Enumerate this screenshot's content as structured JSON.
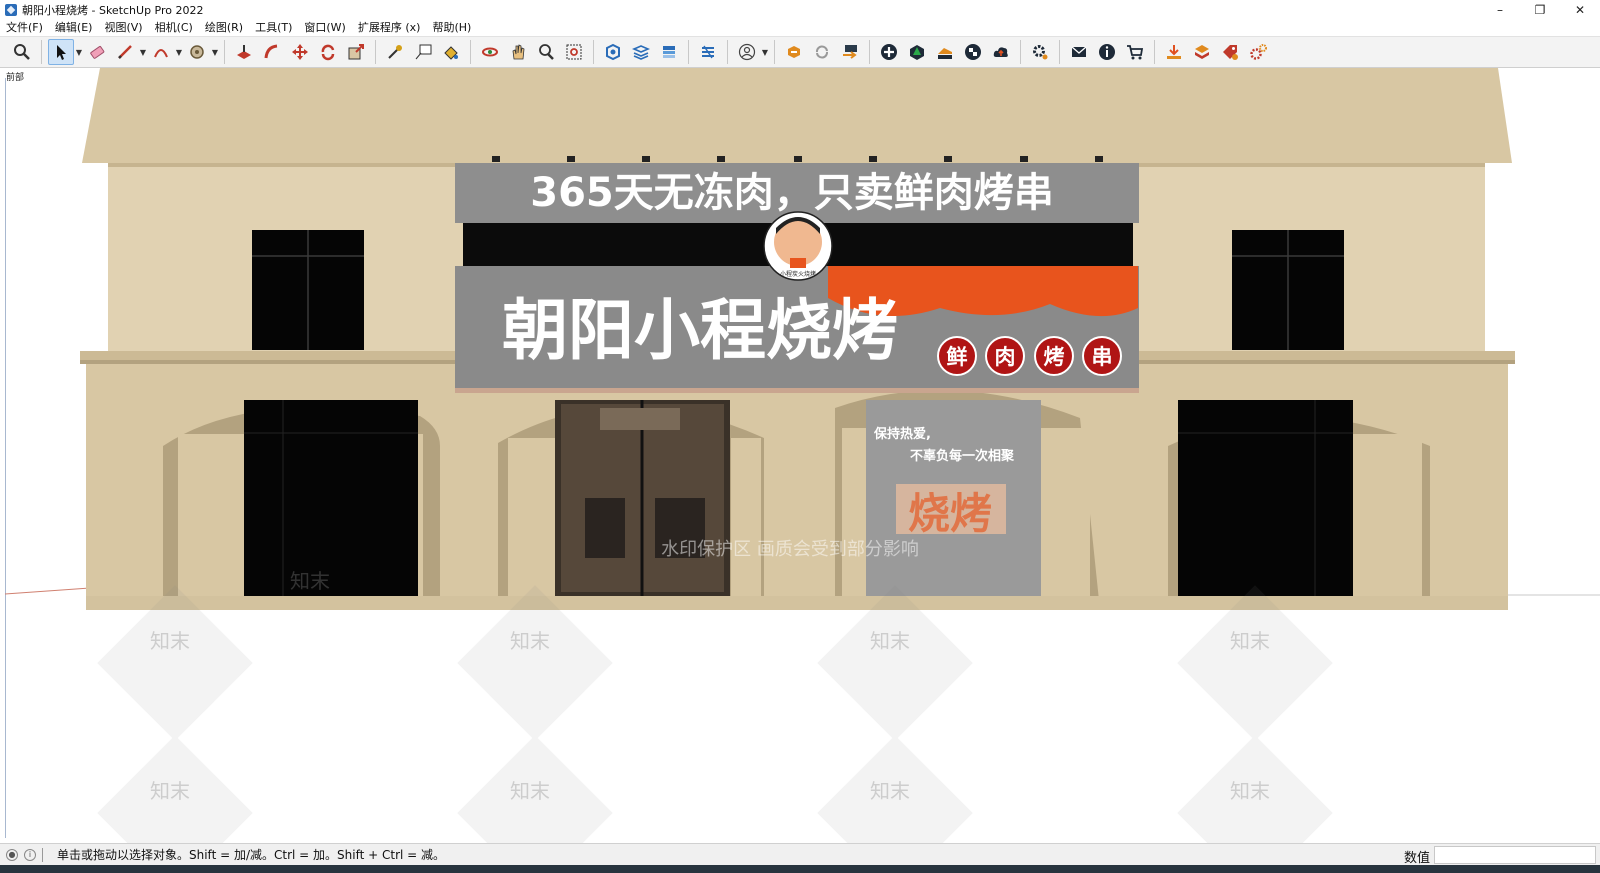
{
  "window": {
    "title": "朝阳小程烧烤 - SketchUp Pro 2022",
    "controls": {
      "minimize": "–",
      "restore": "❐",
      "close": "✕"
    }
  },
  "menu": {
    "items": [
      "文件(F)",
      "编辑(E)",
      "视图(V)",
      "相机(C)",
      "绘图(R)",
      "工具(T)",
      "窗口(W)",
      "扩展程序 (x)",
      "帮助(H)"
    ]
  },
  "toolbar": {
    "active_tool": "select-tool",
    "icons": [
      "zoom-extents-icon",
      "select-icon",
      "eraser-icon",
      "line-pencil-icon",
      "arc-icon",
      "paint-bucket-icon",
      "push-pull-icon",
      "follow-me-icon",
      "move-icon",
      "rotate-icon",
      "scale-icon",
      "tape-measure-icon",
      "text-icon",
      "paint-icon",
      "orbit-icon",
      "pan-icon",
      "zoom-icon",
      "zoom-window-icon",
      "component-icon",
      "layers-icon",
      "styles-icon",
      "scenes-icon",
      "account-icon",
      "extension-warehouse-icon",
      "sync-icon",
      "export-icon",
      "add-icon",
      "tree-icon",
      "terrain-icon",
      "checker-icon",
      "cloud-upload-icon",
      "settings-gear-icon",
      "mail-icon",
      "info-icon",
      "cart-icon",
      "plugin-download-icon",
      "plugin-box-icon",
      "plugin-tag-icon",
      "plugin-gear-icon"
    ]
  },
  "scene": {
    "label": "前部",
    "top_banner": "365天无冻肉，只卖鲜肉烤串",
    "shop_name": "朝阳小程烧烤",
    "tag_chars": [
      "鲜",
      "肉",
      "烤",
      "串"
    ],
    "poster_line1": "保持热爱,",
    "poster_line2": "不辜负每一次相聚",
    "poster_big": "烧烤",
    "avatar_caption": "小程炭火烧烤",
    "watermark_brand": "知末",
    "watermark_notice": "水印保护区  画质会受到部分影响",
    "colors": {
      "facade": "#d8c7a3",
      "facade_shadow": "#b3a27f",
      "concrete": "#8f8f8f",
      "accent_orange": "#e8541d",
      "tag_red": "#b01515",
      "poster_orange": "#e0764a"
    }
  },
  "status": {
    "message": "单击或拖动以选择对象。Shift = 加/减。Ctrl = 加。Shift + Ctrl = 减。",
    "vcb_label": "数值",
    "vcb_value": ""
  }
}
